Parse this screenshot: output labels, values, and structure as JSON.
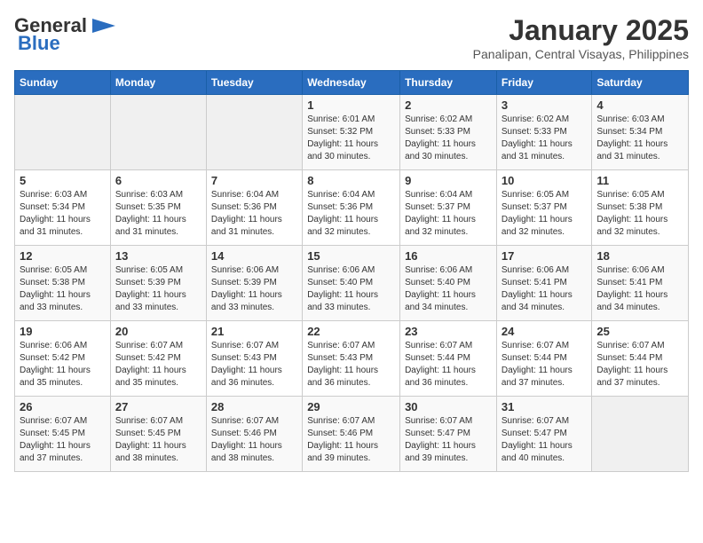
{
  "header": {
    "logo_general": "General",
    "logo_blue": "Blue",
    "month": "January 2025",
    "location": "Panalipan, Central Visayas, Philippines"
  },
  "weekdays": [
    "Sunday",
    "Monday",
    "Tuesday",
    "Wednesday",
    "Thursday",
    "Friday",
    "Saturday"
  ],
  "weeks": [
    [
      {
        "day": "",
        "info": ""
      },
      {
        "day": "",
        "info": ""
      },
      {
        "day": "",
        "info": ""
      },
      {
        "day": "1",
        "info": "Sunrise: 6:01 AM\nSunset: 5:32 PM\nDaylight: 11 hours and 30 minutes."
      },
      {
        "day": "2",
        "info": "Sunrise: 6:02 AM\nSunset: 5:33 PM\nDaylight: 11 hours and 30 minutes."
      },
      {
        "day": "3",
        "info": "Sunrise: 6:02 AM\nSunset: 5:33 PM\nDaylight: 11 hours and 31 minutes."
      },
      {
        "day": "4",
        "info": "Sunrise: 6:03 AM\nSunset: 5:34 PM\nDaylight: 11 hours and 31 minutes."
      }
    ],
    [
      {
        "day": "5",
        "info": "Sunrise: 6:03 AM\nSunset: 5:34 PM\nDaylight: 11 hours and 31 minutes."
      },
      {
        "day": "6",
        "info": "Sunrise: 6:03 AM\nSunset: 5:35 PM\nDaylight: 11 hours and 31 minutes."
      },
      {
        "day": "7",
        "info": "Sunrise: 6:04 AM\nSunset: 5:36 PM\nDaylight: 11 hours and 31 minutes."
      },
      {
        "day": "8",
        "info": "Sunrise: 6:04 AM\nSunset: 5:36 PM\nDaylight: 11 hours and 32 minutes."
      },
      {
        "day": "9",
        "info": "Sunrise: 6:04 AM\nSunset: 5:37 PM\nDaylight: 11 hours and 32 minutes."
      },
      {
        "day": "10",
        "info": "Sunrise: 6:05 AM\nSunset: 5:37 PM\nDaylight: 11 hours and 32 minutes."
      },
      {
        "day": "11",
        "info": "Sunrise: 6:05 AM\nSunset: 5:38 PM\nDaylight: 11 hours and 32 minutes."
      }
    ],
    [
      {
        "day": "12",
        "info": "Sunrise: 6:05 AM\nSunset: 5:38 PM\nDaylight: 11 hours and 33 minutes."
      },
      {
        "day": "13",
        "info": "Sunrise: 6:05 AM\nSunset: 5:39 PM\nDaylight: 11 hours and 33 minutes."
      },
      {
        "day": "14",
        "info": "Sunrise: 6:06 AM\nSunset: 5:39 PM\nDaylight: 11 hours and 33 minutes."
      },
      {
        "day": "15",
        "info": "Sunrise: 6:06 AM\nSunset: 5:40 PM\nDaylight: 11 hours and 33 minutes."
      },
      {
        "day": "16",
        "info": "Sunrise: 6:06 AM\nSunset: 5:40 PM\nDaylight: 11 hours and 34 minutes."
      },
      {
        "day": "17",
        "info": "Sunrise: 6:06 AM\nSunset: 5:41 PM\nDaylight: 11 hours and 34 minutes."
      },
      {
        "day": "18",
        "info": "Sunrise: 6:06 AM\nSunset: 5:41 PM\nDaylight: 11 hours and 34 minutes."
      }
    ],
    [
      {
        "day": "19",
        "info": "Sunrise: 6:06 AM\nSunset: 5:42 PM\nDaylight: 11 hours and 35 minutes."
      },
      {
        "day": "20",
        "info": "Sunrise: 6:07 AM\nSunset: 5:42 PM\nDaylight: 11 hours and 35 minutes."
      },
      {
        "day": "21",
        "info": "Sunrise: 6:07 AM\nSunset: 5:43 PM\nDaylight: 11 hours and 36 minutes."
      },
      {
        "day": "22",
        "info": "Sunrise: 6:07 AM\nSunset: 5:43 PM\nDaylight: 11 hours and 36 minutes."
      },
      {
        "day": "23",
        "info": "Sunrise: 6:07 AM\nSunset: 5:44 PM\nDaylight: 11 hours and 36 minutes."
      },
      {
        "day": "24",
        "info": "Sunrise: 6:07 AM\nSunset: 5:44 PM\nDaylight: 11 hours and 37 minutes."
      },
      {
        "day": "25",
        "info": "Sunrise: 6:07 AM\nSunset: 5:44 PM\nDaylight: 11 hours and 37 minutes."
      }
    ],
    [
      {
        "day": "26",
        "info": "Sunrise: 6:07 AM\nSunset: 5:45 PM\nDaylight: 11 hours and 37 minutes."
      },
      {
        "day": "27",
        "info": "Sunrise: 6:07 AM\nSunset: 5:45 PM\nDaylight: 11 hours and 38 minutes."
      },
      {
        "day": "28",
        "info": "Sunrise: 6:07 AM\nSunset: 5:46 PM\nDaylight: 11 hours and 38 minutes."
      },
      {
        "day": "29",
        "info": "Sunrise: 6:07 AM\nSunset: 5:46 PM\nDaylight: 11 hours and 39 minutes."
      },
      {
        "day": "30",
        "info": "Sunrise: 6:07 AM\nSunset: 5:47 PM\nDaylight: 11 hours and 39 minutes."
      },
      {
        "day": "31",
        "info": "Sunrise: 6:07 AM\nSunset: 5:47 PM\nDaylight: 11 hours and 40 minutes."
      },
      {
        "day": "",
        "info": ""
      }
    ]
  ]
}
